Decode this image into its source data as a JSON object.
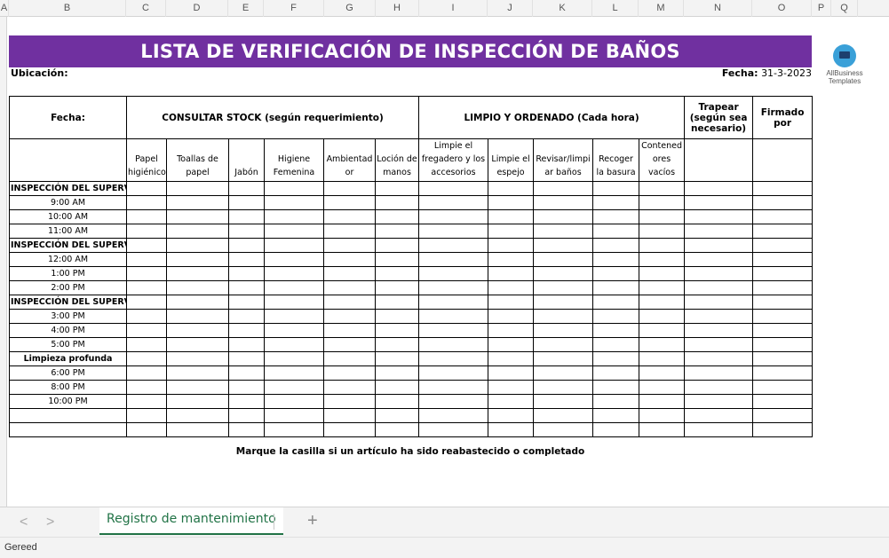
{
  "column_headers": [
    "A",
    "B",
    "C",
    "D",
    "E",
    "F",
    "G",
    "H",
    "I",
    "J",
    "K",
    "L",
    "M",
    "N",
    "O",
    "P",
    "Q"
  ],
  "sheet": {
    "title": "LISTA DE VERIFICACIÓN DE INSPECCIÓN DE BAÑOS",
    "title_bg": "#7030a0",
    "location_label": "Ubicación:",
    "date_label": "Fecha:",
    "date_value": "31-3-2023",
    "logo_line1": "AllBusiness",
    "logo_line2": "Templates",
    "header": {
      "fecha": "Fecha:",
      "stock": "CONSULTAR STOCK (según requerimiento)",
      "limpio": "LIMPIO Y ORDENADO (Cada hora)",
      "trapear": "Trapear (según sea necesario)",
      "firmado": "Firmado por"
    },
    "subheaders": {
      "papel": "Papel higiénico",
      "toallas": "Toallas de papel",
      "jabon": "Jabón",
      "higiene": "Higiene Femenina",
      "ambientador": "Ambientad or",
      "locion": "Loción de manos",
      "fregadero": "Limpie el fregadero y los accesorios",
      "espejo": "Limpie el espejo",
      "banos": "Revisar/limpi ar baños",
      "basura": "Recoger la basura",
      "contenedores": "Contened ores vacíos"
    },
    "rows": [
      {
        "label": "INSPECCIÓN DEL SUPERVISOR",
        "kind": "section"
      },
      {
        "label": "9:00 AM",
        "kind": "time"
      },
      {
        "label": "10:00 AM",
        "kind": "time"
      },
      {
        "label": "11:00 AM",
        "kind": "time"
      },
      {
        "label": "INSPECCIÓN DEL SUPERVISOR",
        "kind": "section"
      },
      {
        "label": "12:00 AM",
        "kind": "time"
      },
      {
        "label": "1:00 PM",
        "kind": "time"
      },
      {
        "label": "2:00 PM",
        "kind": "time"
      },
      {
        "label": "INSPECCIÓN DEL SUPERVISOR",
        "kind": "section"
      },
      {
        "label": "3:00 PM",
        "kind": "time"
      },
      {
        "label": "4:00 PM",
        "kind": "time"
      },
      {
        "label": "5:00 PM",
        "kind": "time"
      },
      {
        "label": "Limpieza profunda",
        "kind": "profunda"
      },
      {
        "label": "6:00 PM",
        "kind": "time"
      },
      {
        "label": "8:00 PM",
        "kind": "time"
      },
      {
        "label": "10:00 PM",
        "kind": "time"
      },
      {
        "label": "",
        "kind": "blank"
      },
      {
        "label": "",
        "kind": "blank"
      }
    ],
    "note": "Marque la casilla si un artículo ha sido reabastecido o completado"
  },
  "tabs": {
    "prev": "<",
    "next": ">",
    "active": "Registro de mantenimiento",
    "add": "+"
  },
  "status": {
    "text": "Gereed"
  }
}
